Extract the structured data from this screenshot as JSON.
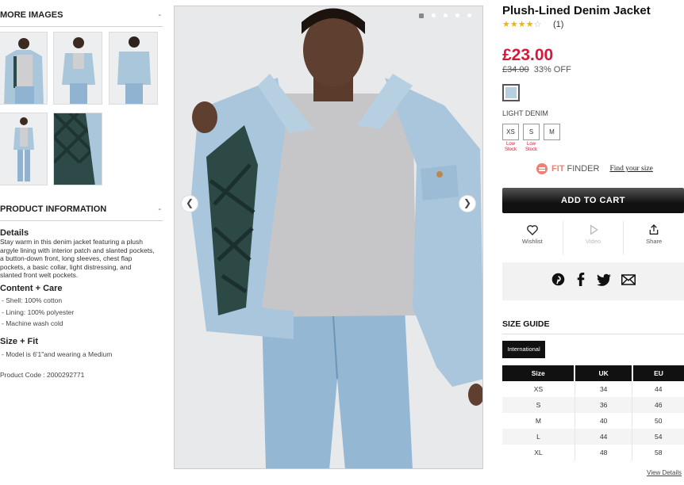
{
  "left": {
    "more_images_title": "MORE IMAGES",
    "collapse_symbol": "-",
    "product_info_title": "PRODUCT INFORMATION",
    "details_title": "Details",
    "details_lines": [
      "Stay warm in this denim jacket featuring a plush",
      "argyle lining with interior patch and slanted pockets,",
      "a button-down front, long sleeves, chest flap",
      "pockets, a basic collar, light distressing, and",
      "slanted front welt pockets."
    ],
    "content_care_title": "Content + Care",
    "content_care": [
      "- Shell: 100% cotton",
      "- Lining: 100% polyester",
      "- Machine wash cold"
    ],
    "size_fit_title": "Size + Fit",
    "size_fit": [
      "- Model is 6'1\"and wearing a Medium"
    ],
    "product_code": "Product Code : 2000292771"
  },
  "gallery": {
    "prev_glyph": "❮",
    "next_glyph": "❯"
  },
  "product": {
    "title": "Plush-Lined Denim Jacket",
    "stars_filled": "★★★★",
    "stars_empty": "☆",
    "rating": 4,
    "review_count": "(1)",
    "price": "£23.00",
    "old_price": "£34.00",
    "discount": "33% OFF",
    "color_name": "LIGHT DENIM",
    "swatch_color": "#b7d0df",
    "sizes": [
      {
        "label": "XS",
        "low_stock": "Low Stock"
      },
      {
        "label": "S",
        "low_stock": "Low Stock"
      },
      {
        "label": "M",
        "low_stock": ""
      }
    ],
    "fit_finder_fit": "FIT",
    "fit_finder_finder": "FINDER",
    "find_your_size": "Find your size",
    "add_to_cart": "ADD TO CART",
    "wishlist_label": "Wishlist",
    "video_label": "Video",
    "share_label": "Share"
  },
  "size_guide": {
    "title": "SIZE GUIDE",
    "international": "International",
    "headers": [
      "Size",
      "UK",
      "EU"
    ],
    "rows": [
      [
        "XS",
        "34",
        "44"
      ],
      [
        "S",
        "36",
        "46"
      ],
      [
        "M",
        "40",
        "50"
      ],
      [
        "L",
        "44",
        "54"
      ],
      [
        "XL",
        "48",
        "58"
      ]
    ],
    "view_details": "View Details"
  },
  "colors": {
    "accent_red": "#d6193a",
    "fit_finder": "#f07e75",
    "star": "#f5b400"
  }
}
